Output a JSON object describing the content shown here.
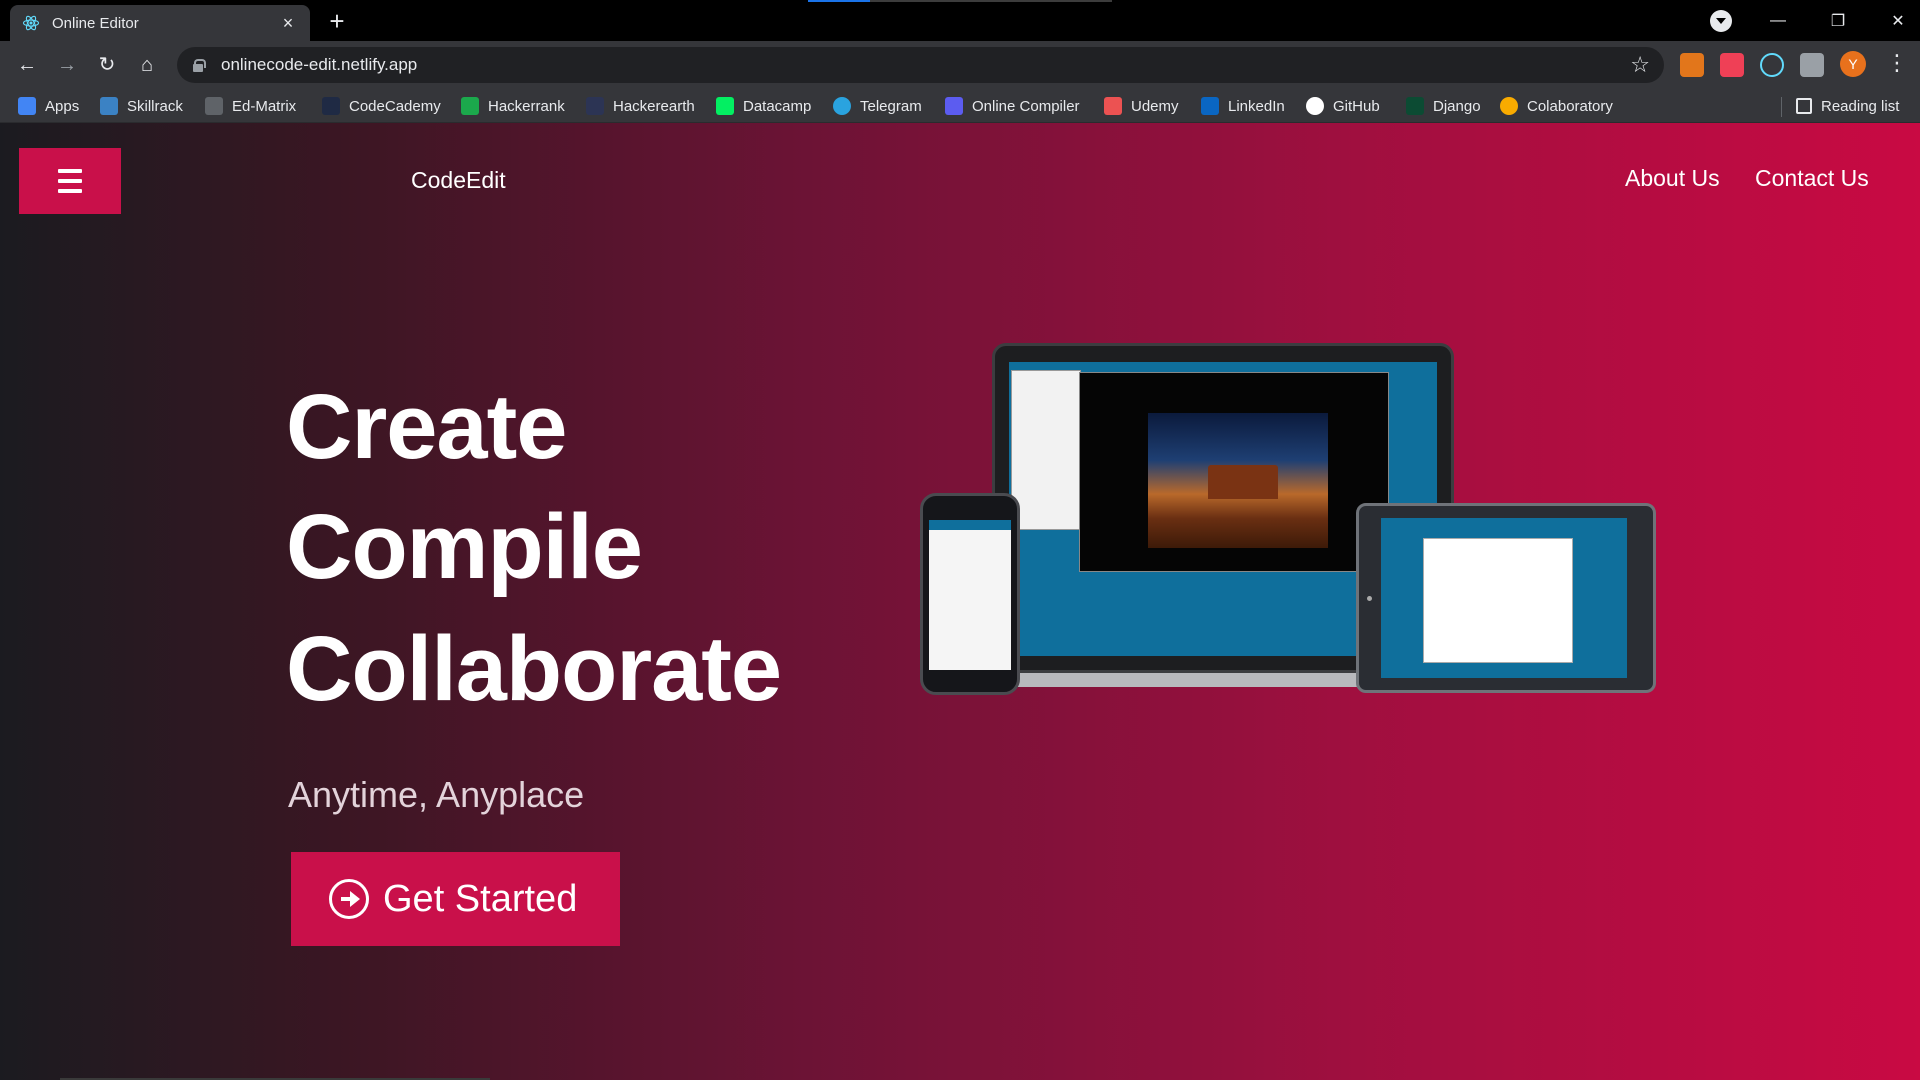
{
  "browser": {
    "tab_title": "Online Editor",
    "tab_close": "×",
    "new_tab": "+",
    "url": "onlinecode-edit.netlify.app",
    "avatar_letter": "Y",
    "window_controls": {
      "minimize": "—",
      "restore": "❐",
      "close": "✕"
    },
    "nav": {
      "back": "←",
      "forward": "→",
      "reload": "↻",
      "home": "⌂",
      "star": "☆",
      "menu": "⋮"
    },
    "bookmarks": [
      {
        "label": "Apps",
        "icon": "apps-grid-icon",
        "color": "#4285f4"
      },
      {
        "label": "Skillrack",
        "icon": "skillrack-icon",
        "color": "#3b82c4"
      },
      {
        "label": "Ed-Matrix",
        "icon": "edmatrix-icon",
        "color": "#5f6368"
      },
      {
        "label": "CodeCademy",
        "icon": "codecademy-icon",
        "color": "#1f2a44"
      },
      {
        "label": "Hackerrank",
        "icon": "hackerrank-icon",
        "color": "#1ba94c"
      },
      {
        "label": "Hackerearth",
        "icon": "hackerearth-icon",
        "color": "#2c3454"
      },
      {
        "label": "Datacamp",
        "icon": "datacamp-icon",
        "color": "#03ef62"
      },
      {
        "label": "Telegram",
        "icon": "telegram-icon",
        "color": "#2aa3df"
      },
      {
        "label": "Online Compiler",
        "icon": "lightning-icon",
        "color": "#5c5cf0"
      },
      {
        "label": "Udemy",
        "icon": "udemy-icon",
        "color": "#ec5252"
      },
      {
        "label": "LinkedIn",
        "icon": "linkedin-icon",
        "color": "#0a66c2"
      },
      {
        "label": "GitHub",
        "icon": "github-icon",
        "color": "#ffffff"
      },
      {
        "label": "Django",
        "icon": "django-icon",
        "color": "#0c4b33"
      },
      {
        "label": "Colaboratory",
        "icon": "colab-icon",
        "color": "#f9ab00"
      }
    ],
    "reading_list": "Reading list"
  },
  "site": {
    "brand": "CodeEdit",
    "nav_links": [
      "About Us",
      "Contact Us"
    ],
    "hero": {
      "lines": [
        "Create",
        "Compile",
        "Collaborate"
      ],
      "tagline": "Anytime, Anyplace",
      "cta_label": "Get Started"
    },
    "colors": {
      "accent": "#c9104a",
      "gradient_start": "#1b1b20",
      "gradient_end": "#c90a43"
    }
  }
}
